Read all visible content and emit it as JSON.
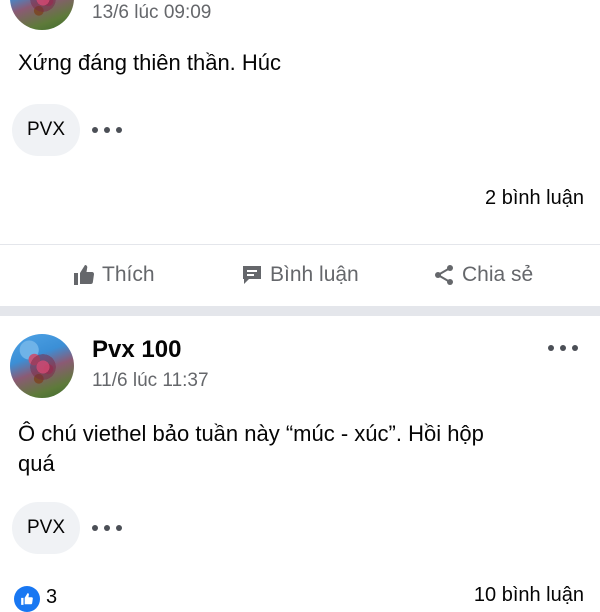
{
  "post1": {
    "timestamp": "13/6 lúc 09:09",
    "text": "Xứng đáng thiên thần. Húc",
    "chip_label": "PVX",
    "comments": "2 bình luận",
    "actions": {
      "like": "Thích",
      "comment": "Bình luận",
      "share": "Chia sẻ"
    }
  },
  "post2": {
    "author": "Pvx 100",
    "timestamp": "11/6 lúc 11:37",
    "text_line1": "Ô chú viethel bảo tuần này “múc - xúc”. Hồi hộp",
    "text_line2": "quá",
    "chip_label": "PVX",
    "likes": "3",
    "comments": "10 bình luận"
  },
  "colors": {
    "secondary_text": "#65676b",
    "like_blue": "#1877f2",
    "divider": "#e4e6eb",
    "chip_bg": "#f0f2f5"
  },
  "icons": [
    "avatar",
    "more-dots-icon",
    "thumbs-up-icon",
    "comment-icon",
    "share-icon"
  ]
}
